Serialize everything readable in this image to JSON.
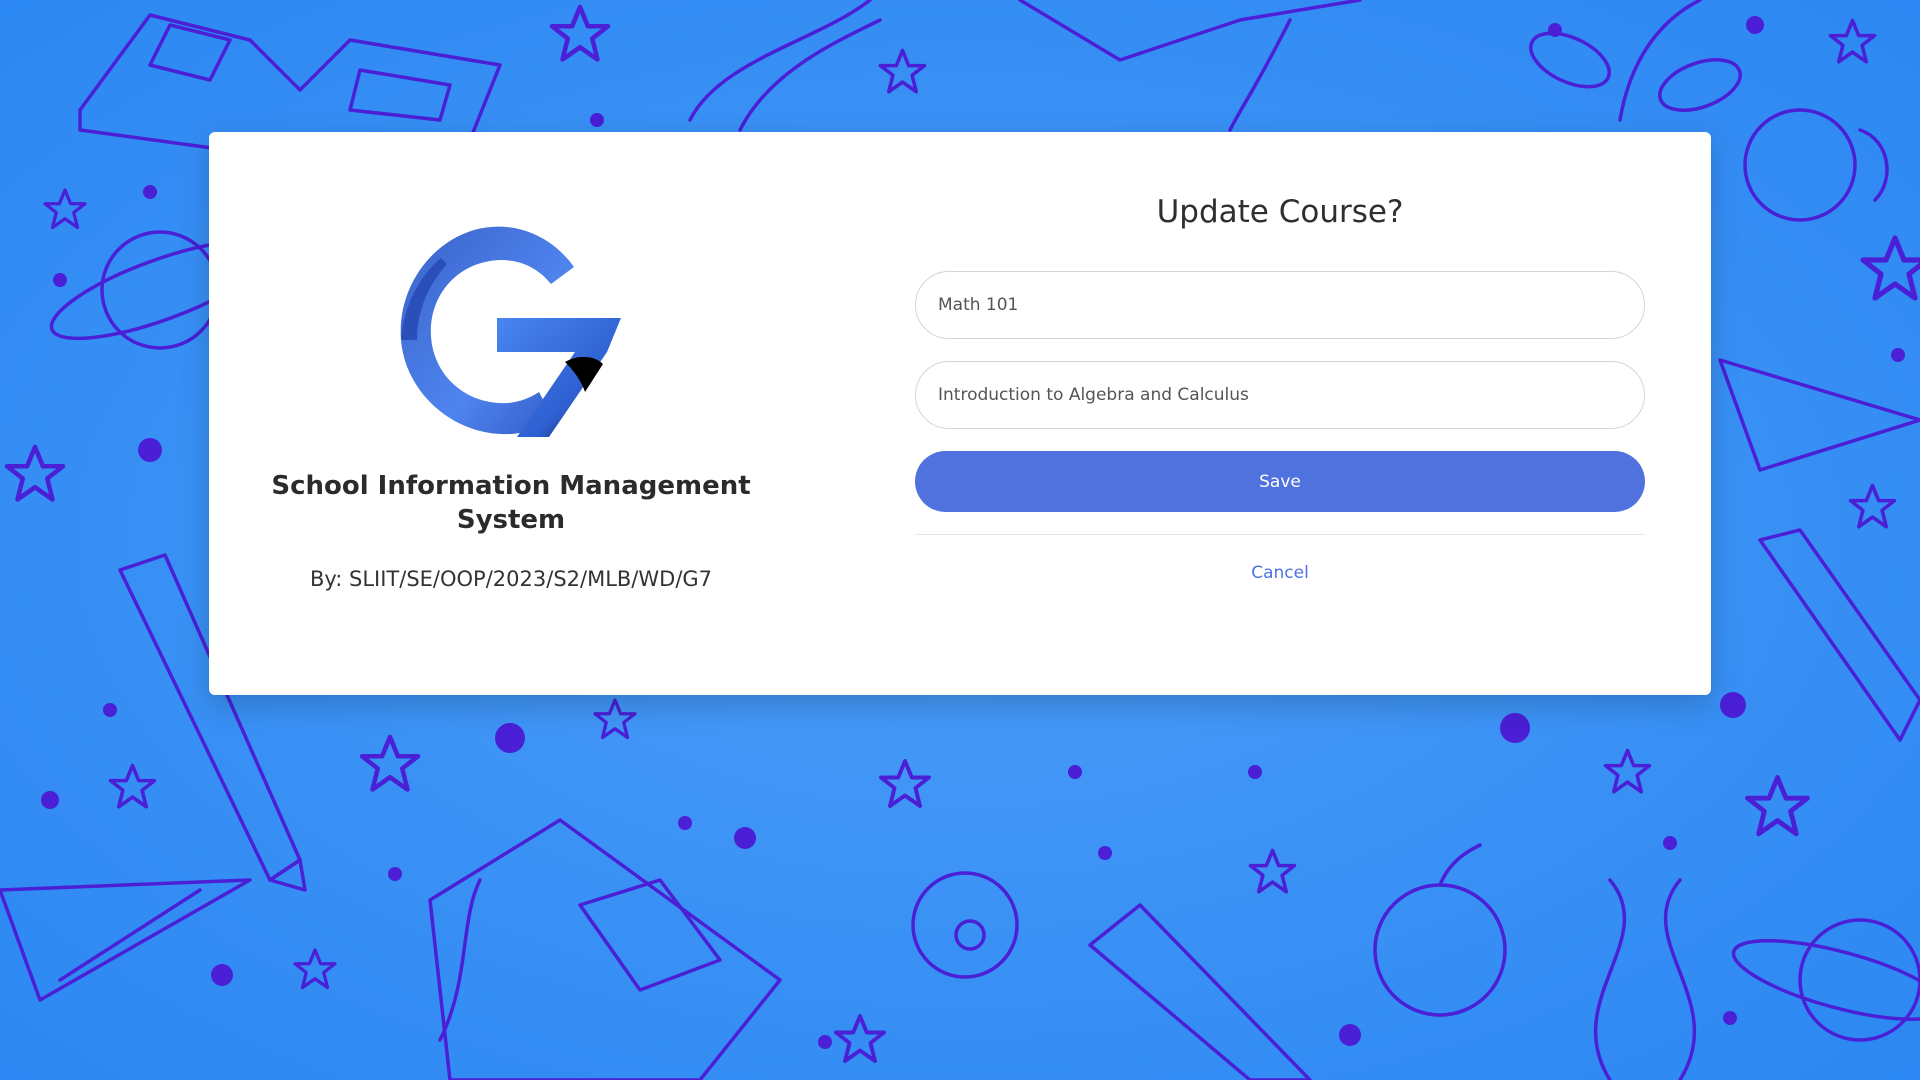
{
  "brand": {
    "logo_icon": "g7-logo-icon",
    "title": "School Information Management System",
    "byline": "By: SLIIT/SE/OOP/2023/S2/MLB/WD/G7"
  },
  "form": {
    "title": "Update Course?",
    "course_name_value": "Math 101",
    "course_description_value": "Introduction to Algebra and Calculus",
    "save_label": "Save",
    "cancel_label": "Cancel"
  },
  "colors": {
    "background": "#2f8cf5",
    "doodle": "#4a1fd6",
    "primary_button": "#4f72df",
    "link": "#4f72df",
    "card": "#ffffff"
  }
}
